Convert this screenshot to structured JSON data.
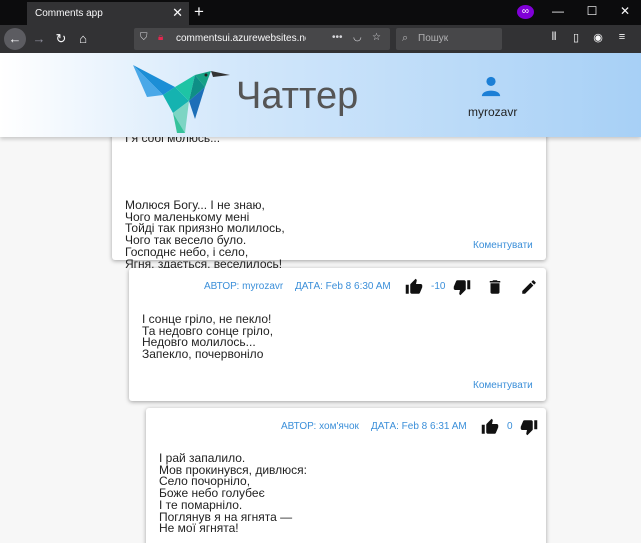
{
  "browser": {
    "tab_title": "Comments app",
    "tab_close": "✕",
    "new_tab": "+",
    "url": "commentsui.azurewebsites.net",
    "search_placeholder": "Пошук"
  },
  "header": {
    "brand": "Чаттер",
    "username": "myrozavr"
  },
  "comments": [
    {
      "body": "Молюся Богу... І не знаю,\nЧого маленькому мені\nТойді так приязно молилось,\nЧого так весело було.\nГосподнє небо, і село,\nЯгня, здається, веселилось!",
      "clipped_top": "І я собі молюсь...",
      "reply": "Коментувати"
    },
    {
      "author_label": "АВТОР: myrozavr",
      "date_label": "ДАТА: Feb 8 6:30 AM",
      "score": "-10",
      "body": "І сонце гріло, не пекло!\nТа недовго сонце гріло,\nНедовго молилось...\nЗапекло, почервоніло",
      "reply": "Коментувати"
    },
    {
      "author_label": "АВТОР: хом'ячок",
      "date_label": "ДАТА: Feb 8 6:31 AM",
      "score": "0",
      "body": "І рай запалило.\nМов прокинувся, дивлюся:\nСело почорніло,\nБоже небо голубеє\nІ те помарніло.\nПоглянув я на ягнята —\nНе мої ягнята!"
    }
  ]
}
